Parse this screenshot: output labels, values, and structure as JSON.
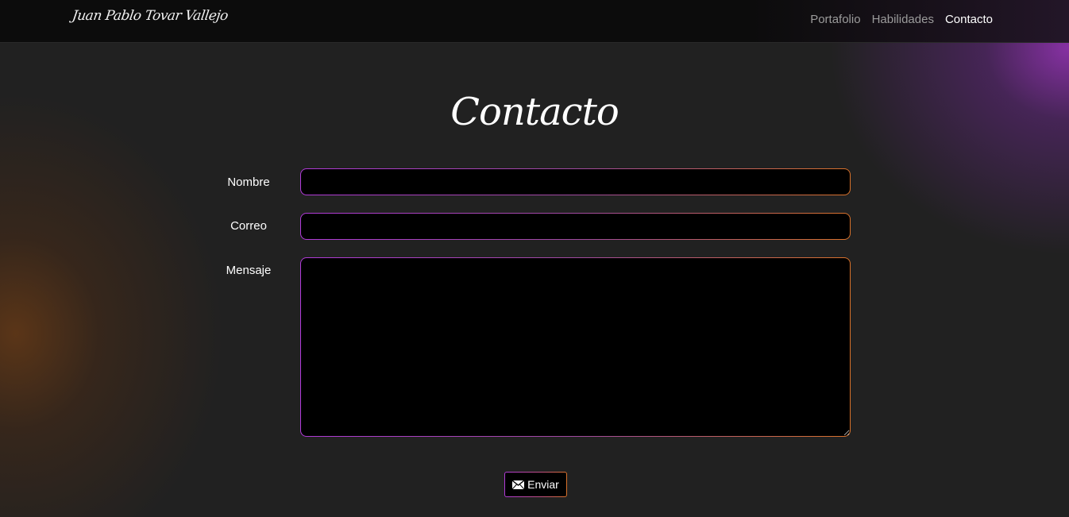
{
  "navbar": {
    "brand": "Juan Pablo Tovar Vallejo",
    "links": [
      {
        "label": "Portafolio",
        "active": false
      },
      {
        "label": "Habilidades",
        "active": false
      },
      {
        "label": "Contacto",
        "active": true
      }
    ]
  },
  "main": {
    "title": "Contacto",
    "form": {
      "name_label": "Nombre",
      "name_value": "",
      "email_label": "Correo",
      "email_value": "",
      "message_label": "Mensaje",
      "message_value": "",
      "submit_label": "Enviar",
      "submit_icon": "envelope-icon"
    }
  },
  "colors": {
    "background": "#212121",
    "navbar": "#0c0c0c",
    "field_background": "#000000",
    "border_gradient_start": "#b03ad8",
    "border_gradient_end": "#d9722a",
    "glow_purple": "#8c32aa",
    "glow_orange": "#6e3c14"
  }
}
